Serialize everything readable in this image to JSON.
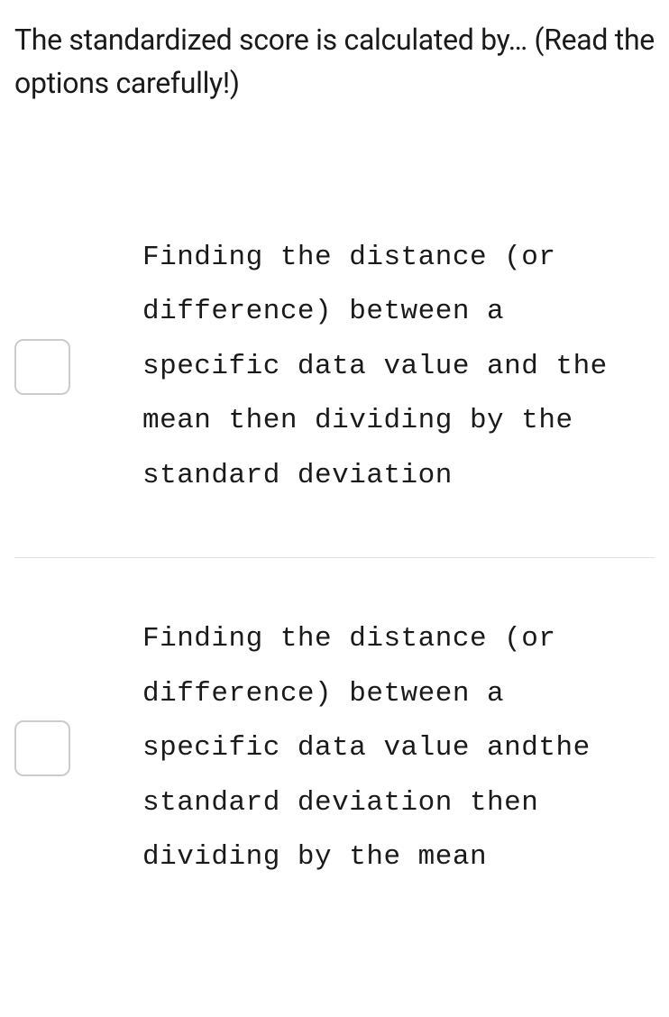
{
  "question": "The standardized score is calculated by… (Read the options carefully!)",
  "options": [
    {
      "text": "Finding the distance (or difference) between a specific data value and the mean then dividing by the standard deviation"
    },
    {
      "text": "Finding the distance (or difference) between a specific data value andthe standard deviation then dividing by the mean"
    }
  ]
}
